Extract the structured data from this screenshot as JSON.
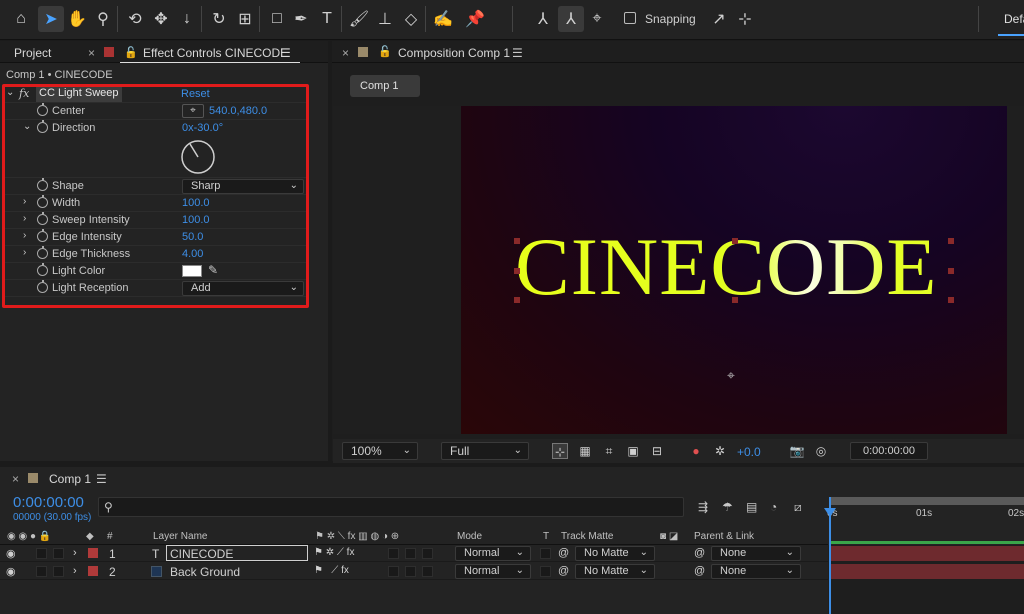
{
  "toolbar": {
    "snapping_label": "Snapping",
    "workspace_label": "Defa"
  },
  "left_panel": {
    "project_tab": "Project",
    "effect_tab": "Effect Controls CINECODE",
    "comp_path": "Comp 1 • CINECODE",
    "effect": {
      "fx_label": "fx",
      "name": "CC Light Sweep",
      "reset_label": "Reset"
    },
    "properties": {
      "center": {
        "name": "Center",
        "value": "540.0,480.0"
      },
      "direction": {
        "name": "Direction",
        "value": "0x-30.0°"
      },
      "shape": {
        "name": "Shape",
        "value": "Sharp"
      },
      "width": {
        "name": "Width",
        "value": "100.0"
      },
      "sweep_intensity": {
        "name": "Sweep Intensity",
        "value": "100.0"
      },
      "edge_intensity": {
        "name": "Edge Intensity",
        "value": "50.0"
      },
      "edge_thickness": {
        "name": "Edge Thickness",
        "value": "4.00"
      },
      "light_color": {
        "name": "Light Color",
        "color": "#ffffff"
      },
      "light_reception": {
        "name": "Light Reception",
        "value": "Add"
      }
    }
  },
  "comp_panel": {
    "tab_label": "Composition Comp 1",
    "chip_label": "Comp 1",
    "canvas_text": "CINECODE",
    "zoom": "100%",
    "resolution": "Full",
    "exposure": "+0.0",
    "time": "0:00:00:00"
  },
  "timeline": {
    "tab_label": "Comp 1",
    "timecode": "0:00:00:00",
    "frames": "00000 (30.00 fps)",
    "columns": {
      "num": "#",
      "layer_name": "Layer Name",
      "mode": "Mode",
      "t": "T",
      "track_matte": "Track Matte",
      "parent": "Parent & Link"
    },
    "ruler": [
      "0s",
      "01s",
      "02s"
    ],
    "layers": [
      {
        "num": "1",
        "type_glyph": "T",
        "name": "CINECODE",
        "mode": "Normal",
        "matte": "No Matte",
        "parent": "None",
        "color": "#b03a3a"
      },
      {
        "num": "2",
        "type_glyph": "",
        "name": "Back Ground",
        "mode": "Normal",
        "matte": "No Matte",
        "parent": "None",
        "color": "#b03a3a"
      }
    ]
  }
}
